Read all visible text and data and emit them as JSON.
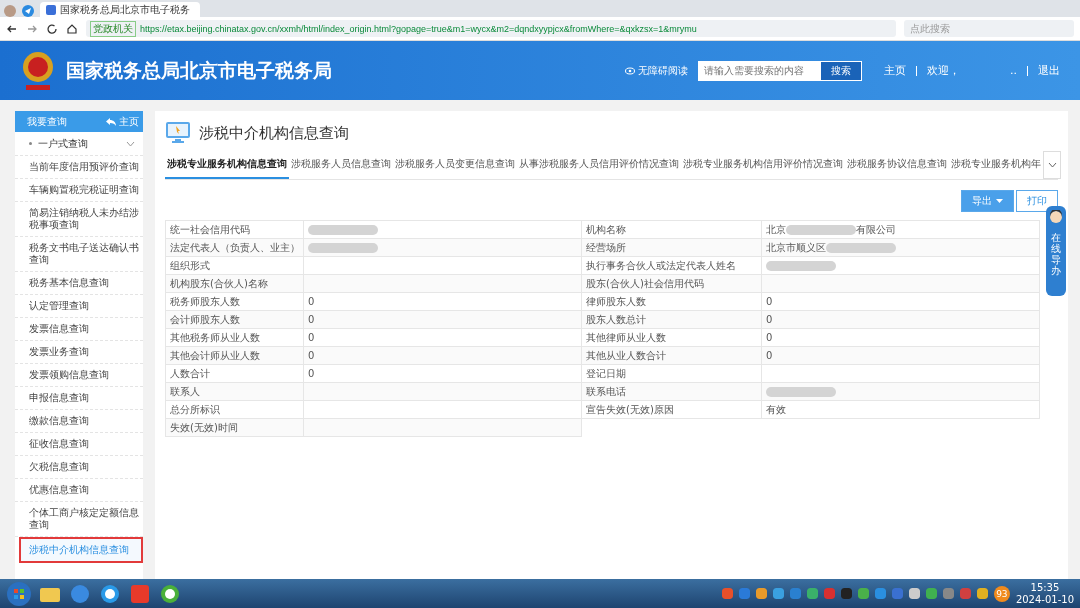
{
  "browser": {
    "tab_title": "国家税务总局北京市电子税务",
    "url_badge": "党政机关",
    "url": "https://etax.beijing.chinatax.gov.cn/xxmh/html/index_origin.html?gopage=true&m1=wycx&m2=dqndxyypjcx&fromWhere=&qxkzsx=1&mrymu",
    "search_placeholder": "点此搜索"
  },
  "header": {
    "title": "国家税务总局北京市电子税务局",
    "accessibility": "无障碍阅读",
    "search_placeholder": "请输入需要搜索的内容",
    "search_button": "搜索",
    "links": [
      "主页",
      "欢迎，",
      "..",
      "退出"
    ]
  },
  "sidebar": {
    "title": "我要查询",
    "home": "主页",
    "group": {
      "label": "一户式查询",
      "expanded": true,
      "children": [
        {
          "label": "当前年度信用预评价查询",
          "selected": false
        },
        {
          "label": "车辆购置税完税证明查询",
          "selected": false
        },
        {
          "label": "简易注销纳税人未办结涉税事项查询",
          "selected": false
        },
        {
          "label": "税务文书电子送达确认书查询",
          "selected": false
        },
        {
          "label": "税务基本信息查询",
          "selected": false
        },
        {
          "label": "认定管理查询",
          "selected": false
        },
        {
          "label": "发票信息查询",
          "selected": false
        },
        {
          "label": "发票业务查询",
          "selected": false
        },
        {
          "label": "发票领购信息查询",
          "selected": false
        },
        {
          "label": "申报信息查询",
          "selected": false
        },
        {
          "label": "缴款信息查询",
          "selected": false
        },
        {
          "label": "征收信息查询",
          "selected": false
        },
        {
          "label": "欠税信息查询",
          "selected": false
        },
        {
          "label": "优惠信息查询",
          "selected": false
        },
        {
          "label": "个体工商户核定定额信息查询",
          "selected": false
        },
        {
          "label": "涉税中介机构信息查询",
          "selected": true
        }
      ]
    }
  },
  "page": {
    "title": "涉税中介机构信息查询",
    "tabs": [
      {
        "label": "涉税专业服务机构信息查询",
        "selected": true
      },
      {
        "label": "涉税服务人员信息查询",
        "selected": false
      },
      {
        "label": "涉税服务人员变更信息查询",
        "selected": false
      },
      {
        "label": "从事涉税服务人员信用评价情况查询",
        "selected": false
      },
      {
        "label": "涉税专业服务机构信用评价情况查询",
        "selected": false
      },
      {
        "label": "涉税服务协议信息查询",
        "selected": false
      },
      {
        "label": "涉税专业服务机构年",
        "selected": false
      }
    ],
    "buttons": [
      {
        "label": "导出",
        "kind": "dropdown"
      },
      {
        "label": "打印",
        "kind": "plain"
      }
    ],
    "rows": [
      [
        {
          "label": "统一社会信用代码",
          "value": [
            {
              "kind": "masked"
            }
          ]
        },
        {
          "label": "机构名称",
          "value": [
            {
              "kind": "text",
              "text": "北京"
            },
            {
              "kind": "masked"
            },
            {
              "kind": "text",
              "text": "有限公司"
            }
          ]
        }
      ],
      [
        {
          "label": "法定代表人（负责人、业主）",
          "value": [
            {
              "kind": "masked"
            }
          ]
        },
        {
          "label": "经营场所",
          "value": [
            {
              "kind": "text",
              "text": "北京市顺义区"
            },
            {
              "kind": "masked"
            }
          ]
        }
      ],
      [
        {
          "label": "组织形式"
        },
        {
          "label": "执行事务合伙人或法定代表人姓名",
          "value": [
            {
              "kind": "masked"
            }
          ]
        }
      ],
      [
        {
          "label": "机构股东(合伙人)名称"
        },
        {
          "label": "股东(合伙人)社会信用代码"
        }
      ],
      [
        {
          "label": "税务师股东人数",
          "value": [
            {
              "kind": "text",
              "text": "0"
            }
          ]
        },
        {
          "label": "律师股东人数",
          "value": [
            {
              "kind": "text",
              "text": "0"
            }
          ]
        }
      ],
      [
        {
          "label": "会计师股东人数",
          "value": [
            {
              "kind": "text",
              "text": "0"
            }
          ]
        },
        {
          "label": "股东人数总计",
          "value": [
            {
              "kind": "text",
              "text": "0"
            }
          ]
        }
      ],
      [
        {
          "label": "其他税务师从业人数",
          "value": [
            {
              "kind": "text",
              "text": "0"
            }
          ]
        },
        {
          "label": "其他律师从业人数",
          "value": [
            {
              "kind": "text",
              "text": "0"
            }
          ]
        }
      ],
      [
        {
          "label": "其他会计师从业人数",
          "value": [
            {
              "kind": "text",
              "text": "0"
            }
          ]
        },
        {
          "label": "其他从业人数合计",
          "value": [
            {
              "kind": "text",
              "text": "0"
            }
          ]
        }
      ],
      [
        {
          "label": "人数合计",
          "value": [
            {
              "kind": "text",
              "text": "0"
            }
          ]
        },
        {
          "label": "登记日期"
        }
      ],
      [
        {
          "label": "联系人"
        },
        {
          "label": "联系电话",
          "value": [
            {
              "kind": "masked"
            }
          ]
        }
      ],
      [
        {
          "label": "总分所标识"
        },
        {
          "label": "宣告失效(无效)原因",
          "value": [
            {
              "kind": "text",
              "text": "有效"
            }
          ]
        }
      ],
      [
        {
          "label": "失效(无效)时间"
        }
      ]
    ]
  },
  "side_widget": {
    "label": "在线导办"
  },
  "taskbar": {
    "badge": "93",
    "time": "15:35",
    "date": "2024-01-10"
  }
}
